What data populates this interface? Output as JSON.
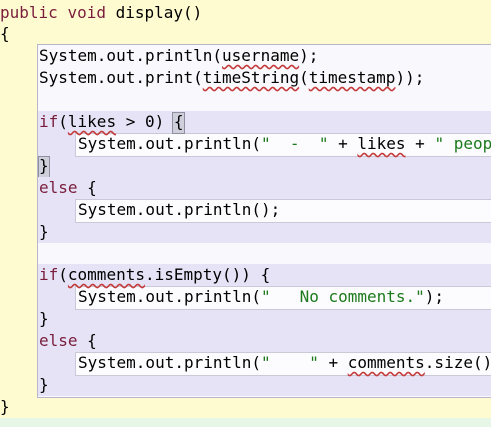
{
  "code": {
    "line1": {
      "kw1": "public",
      "kw2": "void",
      "rest": " display()"
    },
    "open_brace": "{",
    "l_println_user": {
      "pre": "System.out.println(",
      "sq": "username",
      "post": ");"
    },
    "l_print_time": {
      "pre": "System.out.print(",
      "sq1": "timeString",
      "mid": "(",
      "sq2": "timestamp",
      "post": "));"
    },
    "l_if_likes": {
      "kw": "if",
      "p1": "(",
      "sq": "likes",
      "post": " > 0) ",
      "brace": "{"
    },
    "l_likes_println": {
      "pre": "System.out.println(",
      "s1": "\"  -  \"",
      "mid": " + ",
      "sq": "likes",
      "mid2": " + ",
      "s2": "\" peop"
    },
    "close_brace_hl": "}",
    "else1": {
      "kw": "else",
      "rest": " {"
    },
    "l_println_empty": "System.out.println();",
    "close1": "}",
    "l_if_comments": {
      "kw": "if",
      "p1": "(",
      "sq": "comments",
      "post": ".isEmpty()) {"
    },
    "l_nocomments": {
      "pre": "System.out.println(",
      "s": "\"   No comments.\"",
      "post": ");"
    },
    "close2": "}",
    "else2": {
      "kw": "else",
      "rest": " {"
    },
    "l_comments_size": {
      "pre": "System.out.println(",
      "s": "\"    \"",
      "mid": " + ",
      "sq": "comments",
      "post": ".size() +"
    },
    "close3": "}",
    "final_brace": "}"
  }
}
